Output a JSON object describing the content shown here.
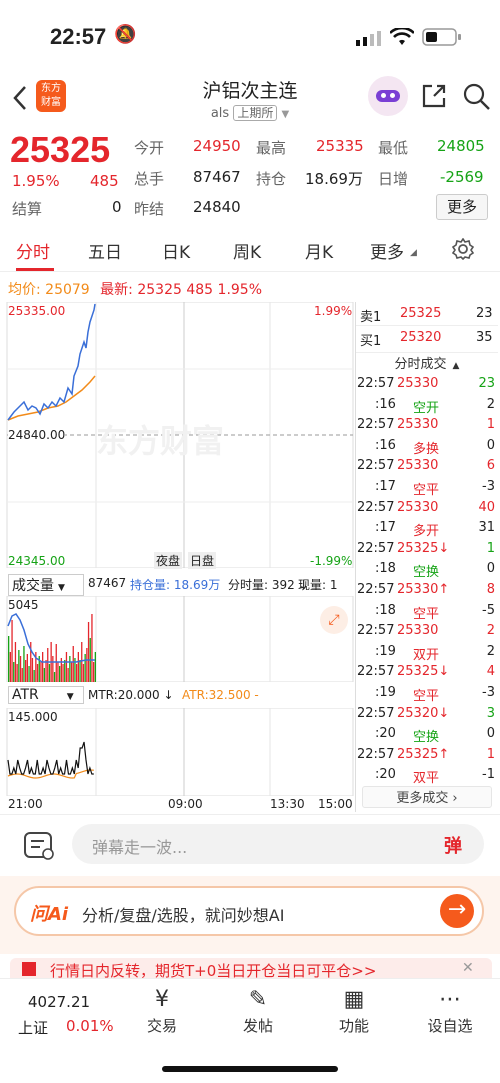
{
  "status": {
    "time": "22:57"
  },
  "header": {
    "back_icon": "chevron-left-icon",
    "logo_text": "东方\n财富",
    "title": "沪铝次主连",
    "code": "als",
    "exchange": "上期所",
    "share_icon": "share-icon",
    "search_icon": "search-icon"
  },
  "quote": {
    "price": "25325",
    "change_pct": "1.95%",
    "change": "485",
    "settle_label": "结算",
    "settle_value": "0",
    "open_label": "今开",
    "open_value": "24950",
    "high_label": "最高",
    "high_value": "25335",
    "low_label": "最低",
    "low_value": "24805",
    "volume_label": "总手",
    "volume_value": "87467",
    "oi_label": "持仓",
    "oi_value": "18.69万",
    "oi_change_label": "日增",
    "oi_change_value": "-2569",
    "prev_settle_label": "昨结",
    "prev_settle_value": "24840",
    "more_label": "更多"
  },
  "tabs": [
    "分时",
    "五日",
    "日K",
    "周K",
    "月K",
    "更多"
  ],
  "info_line": {
    "avg_label": "均价:",
    "avg_value": "25079",
    "latest_label": "最新:",
    "latest_value": "25325",
    "latest_change": "485",
    "latest_pct": "1.95%"
  },
  "chart": {
    "y_top": "25335.00",
    "y_mid": "24840.00",
    "y_bottom": "24345.00",
    "pct_top": "1.99%",
    "pct_bottom": "-1.99%",
    "watermark": "东方财富",
    "night_label": "夜盘",
    "day_label": "日盘",
    "x_labels": [
      "21:00",
      "09:00",
      "13:30",
      "15:00"
    ]
  },
  "volume_panel": {
    "selector": "成交量",
    "total": "87467",
    "oi_text": "持仓量: 18.69万",
    "tick_vol": "分时量: 392 ↓",
    "now_vol": "现量: 1",
    "y_max": "5045"
  },
  "atr_panel": {
    "selector": "ATR",
    "mtr": "MTR:20.000 ↓",
    "atr": "ATR:32.500 -",
    "y_max": "145.000"
  },
  "orderbook": {
    "ask_label": "卖1",
    "ask_price": "25325",
    "ask_vol": "23",
    "bid_label": "买1",
    "bid_price": "25320",
    "bid_vol": "35",
    "trades_title": "分时成交"
  },
  "trades": [
    {
      "time": "22:57",
      "price": "25330",
      "vol": "23",
      "color": "red",
      "volcolor": "green"
    },
    {
      "time": ":16",
      "price": "空开",
      "vol": "2",
      "color": "green",
      "volcolor": "dark"
    },
    {
      "time": "22:57",
      "price": "25330",
      "vol": "1",
      "color": "red",
      "volcolor": "red"
    },
    {
      "time": ":16",
      "price": "多换",
      "vol": "0",
      "color": "red",
      "volcolor": "dark"
    },
    {
      "time": "22:57",
      "price": "25330",
      "vol": "6",
      "color": "red",
      "volcolor": "red"
    },
    {
      "time": ":17",
      "price": "空平",
      "vol": "-3",
      "color": "red",
      "volcolor": "dark"
    },
    {
      "time": "22:57",
      "price": "25330",
      "vol": "40",
      "color": "red",
      "volcolor": "red"
    },
    {
      "time": ":17",
      "price": "多开",
      "vol": "31",
      "color": "red",
      "volcolor": "dark"
    },
    {
      "time": "22:57",
      "price": "25325↓",
      "vol": "1",
      "color": "red",
      "volcolor": "green"
    },
    {
      "time": ":18",
      "price": "空换",
      "vol": "0",
      "color": "green",
      "volcolor": "dark"
    },
    {
      "time": "22:57",
      "price": "25330↑",
      "vol": "8",
      "color": "red",
      "volcolor": "red"
    },
    {
      "time": ":18",
      "price": "空平",
      "vol": "-5",
      "color": "red",
      "volcolor": "dark"
    },
    {
      "time": "22:57",
      "price": "25330",
      "vol": "2",
      "color": "red",
      "volcolor": "red"
    },
    {
      "time": ":19",
      "price": "双开",
      "vol": "2",
      "color": "red",
      "volcolor": "dark"
    },
    {
      "time": "22:57",
      "price": "25325↓",
      "vol": "4",
      "color": "red",
      "volcolor": "red"
    },
    {
      "time": ":19",
      "price": "空平",
      "vol": "-3",
      "color": "red",
      "volcolor": "dark"
    },
    {
      "time": "22:57",
      "price": "25320↓",
      "vol": "3",
      "color": "red",
      "volcolor": "green"
    },
    {
      "time": ":20",
      "price": "空换",
      "vol": "0",
      "color": "green",
      "volcolor": "dark"
    },
    {
      "time": "22:57",
      "price": "25325↑",
      "vol": "1",
      "color": "red",
      "volcolor": "red"
    },
    {
      "time": ":20",
      "price": "双平",
      "vol": "-1",
      "color": "red",
      "volcolor": "dark"
    }
  ],
  "more_trades_label": "更多成交",
  "danmu": {
    "placeholder": "弹幕走一波...",
    "send_label": "弹"
  },
  "ai": {
    "logo": "问Ai",
    "text": "分析/复盘/选股，就问妙想AI",
    "go_icon": "arrow-right-icon"
  },
  "news": {
    "text": "行情日内反转，期货T+0当日开仓当日可平仓>>",
    "close": "✕"
  },
  "nav": {
    "index_value": "4027.21",
    "index_name": "上证",
    "index_pct": "0.01%",
    "items": [
      "交易",
      "发帖",
      "功能",
      "设自选"
    ]
  },
  "colors": {
    "up": "#e4262c",
    "down": "#16a316",
    "price_line": "#3a6fd8",
    "avg_line": "#f28b1a",
    "accent": "#f55a1c"
  }
}
